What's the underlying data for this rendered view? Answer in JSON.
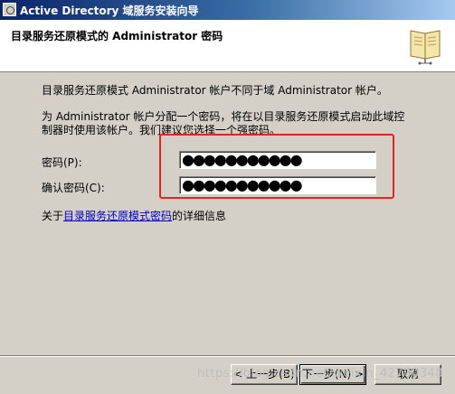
{
  "window": {
    "title": "Active Directory 域服务安装向导"
  },
  "header": {
    "title": "目录服务还原模式的 Administrator 密码"
  },
  "body": {
    "line1": "目录服务还原模式 Administrator 帐户不同于域 Administrator 帐户。",
    "line2a": "为 Administrator 帐户分配一个密码，将在以目录服务还原模式启动此域控",
    "line2b": "制器时使用该帐户。我们建议您选择一个强密码。"
  },
  "fields": {
    "password_label": "密码(P):",
    "password_value": "●●●●●●●●●●●",
    "confirm_label": "确认密码(C):",
    "confirm_value": "●●●●●●●●●●●"
  },
  "more_info": {
    "prefix": "关于",
    "link": "目录服务还原模式密码",
    "suffix": "的详细信息"
  },
  "buttons": {
    "back": "< 上一步(B)",
    "next": "下一步(N) >",
    "cancel": "取消"
  },
  "watermark": "https://blog.csdn.net/weixin_42700348"
}
